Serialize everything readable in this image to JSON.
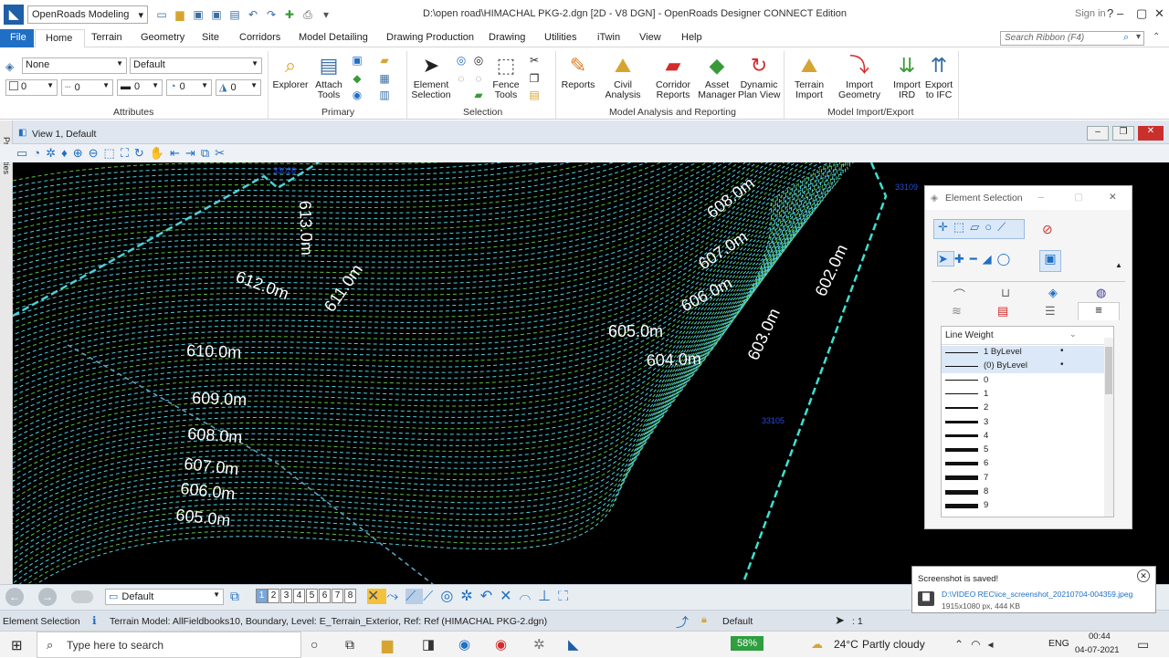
{
  "titlebar": {
    "workspace": "OpenRoads Modeling",
    "window_title": "D:\\open road\\HIMACHAL PKG-2.dgn [2D - V8 DGN] - OpenRoads Designer CONNECT Edition",
    "signin": "Sign in"
  },
  "tabs": [
    "File",
    "Home",
    "Terrain",
    "Geometry",
    "Site",
    "Corridors",
    "Model Detailing",
    "Drawing Production",
    "Drawing",
    "Utilities",
    "iTwin",
    "View",
    "Help"
  ],
  "ribbon": {
    "search_placeholder": "Search Ribbon (F4)",
    "attributes": {
      "level": "None",
      "style": "Default",
      "color": "0",
      "weight": "0",
      "linestyle": "0",
      "transparency": "0",
      "priority": "0",
      "class": "0",
      "label": "Attributes"
    },
    "primary": {
      "explorer": "Explorer",
      "attach_tools": "Attach\nTools",
      "label": "Primary"
    },
    "selection": {
      "element_selection": "Element\nSelection",
      "fence": "Fence\nTools",
      "label": "Selection"
    },
    "analysis": {
      "reports": "Reports",
      "civil_analysis": "Civil\nAnalysis",
      "corridor_reports": "Corridor\nReports",
      "asset_manager": "Asset\nManager",
      "dynamic_plan_view": "Dynamic\nPlan View",
      "label": "Model Analysis and Reporting"
    },
    "import_export": {
      "terrain_import": "Terrain\nImport",
      "import_geometry": "Import\nGeometry",
      "import_ird": "Import\nIRD",
      "export_ifc": "Export\nto IFC",
      "label": "Model Import/Export"
    }
  },
  "view": {
    "title": "View 1, Default",
    "props_label": "Properties"
  },
  "contours": [
    {
      "text": "613.0m"
    },
    {
      "text": "612.0m"
    },
    {
      "text": "611.0m"
    },
    {
      "text": "610.0m"
    },
    {
      "text": "609.0m"
    },
    {
      "text": "608.0m"
    },
    {
      "text": "607.0m"
    },
    {
      "text": "606.0m"
    },
    {
      "text": "605.0m"
    },
    {
      "text": "605.0m"
    },
    {
      "text": "604.0m"
    },
    {
      "text": "603.0m"
    },
    {
      "text": "602.0m"
    },
    {
      "text": "608.0m"
    },
    {
      "text": "607.0m"
    },
    {
      "text": "606.0m"
    }
  ],
  "point_labels": [
    "33028",
    "33109",
    "33105"
  ],
  "element_selection": {
    "title": "Element Selection",
    "list_header": "Line Weight",
    "items": [
      "1 ByLevel",
      "(0) ByLevel",
      "0",
      "1",
      "2",
      "3",
      "4",
      "5",
      "6",
      "7",
      "8",
      "9"
    ]
  },
  "bottombar": {
    "view_group": "Default",
    "pages": [
      "1",
      "2",
      "3",
      "4",
      "5",
      "6",
      "7",
      "8"
    ]
  },
  "status": {
    "tool": "Element Selection",
    "message": "Terrain Model: AllFieldbooks10, Boundary, Level: E_Terrain_Exterior, Ref: Ref (HIMACHAL PKG-2.dgn)",
    "level": "Default",
    "scale": ": 1"
  },
  "toast": {
    "title": "Screenshot is saved!",
    "path": "D:\\VIDEO REC\\ice_screenshot_20210704-004359.jpeg",
    "info": "1915x1080 px, 444 KB"
  },
  "taskbar": {
    "search_placeholder": "Type here to search",
    "battery": "58%",
    "weather_temp": "24°C",
    "weather_desc": "Partly cloudy",
    "lang": "ENG",
    "time": "00:44",
    "date": "04-07-2021"
  },
  "colors": {
    "accent": "#1f6fc5",
    "canvas": "#000000",
    "contour_a": "#4fd0d8",
    "contour_b": "#5fbf3f",
    "boundary": "#3ee0d0"
  }
}
